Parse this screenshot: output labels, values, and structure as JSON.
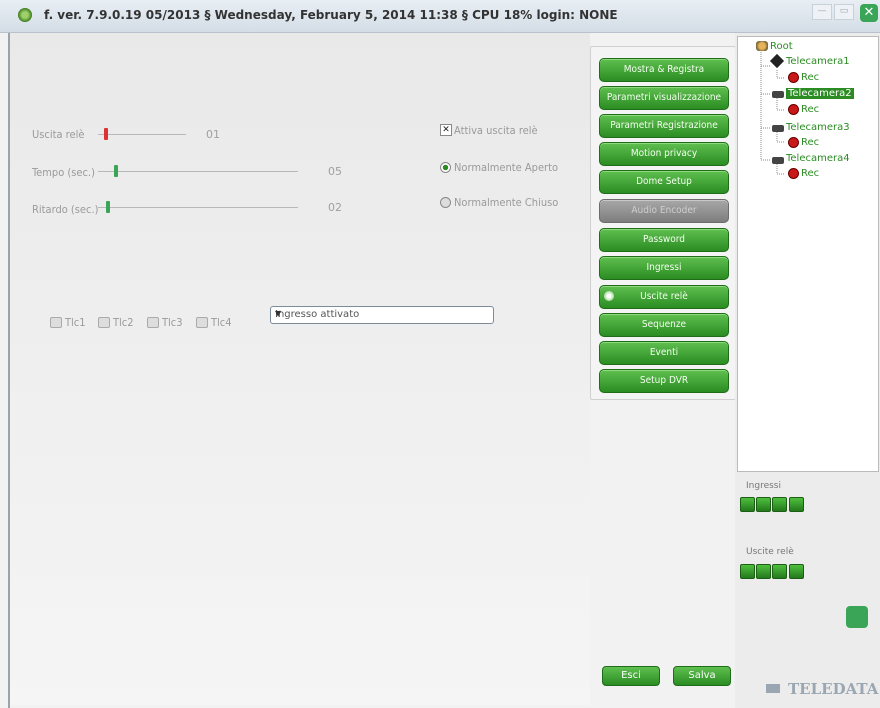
{
  "titlebar": {
    "title": "f. ver. 7.9.0.19  05/2013   § Wednesday, February 5, 2014 11:38   § CPU 18%   login: NONE",
    "min_label": "—",
    "max_label": "▭",
    "close_label": "✕"
  },
  "relay": {
    "uscita_label": "Uscita relè",
    "uscita_value": "01",
    "tempo_label": "Tempo (sec.)",
    "tempo_value": "05",
    "ritardo_label": "Ritardo (sec.)",
    "ritardo_value": "02",
    "attiva_label": "Attiva uscita relè",
    "aperto_label": "Normalmente Aperto",
    "chiuso_label": "Normalmente Chiuso"
  },
  "tlc": [
    "Tlc1",
    "Tlc2",
    "Tlc3",
    "Tlc4"
  ],
  "select": {
    "value": "Ingresso attivato"
  },
  "buttons": [
    {
      "label": "Mostra & Registra",
      "enabled": true
    },
    {
      "label": "Parametri visualizzazione",
      "enabled": true
    },
    {
      "label": "Parametri Registrazione",
      "enabled": true
    },
    {
      "label": "Motion privacy",
      "enabled": true
    },
    {
      "label": "Dome Setup",
      "enabled": true
    },
    {
      "label": "Audio Encoder",
      "enabled": false
    },
    {
      "label": "Password",
      "enabled": true
    },
    {
      "label": "Ingressi",
      "enabled": true
    },
    {
      "label": "Uscite relè",
      "enabled": true
    },
    {
      "label": "Sequenze",
      "enabled": true
    },
    {
      "label": "Eventi",
      "enabled": true
    },
    {
      "label": "Setup DVR",
      "enabled": true
    }
  ],
  "tree": {
    "root": "Root",
    "cameras": [
      "Telecamera1",
      "Telecamera2",
      "Telecamera3",
      "Telecamera4"
    ],
    "rec_label": "Rec",
    "selected": "Telecamera2"
  },
  "ingressi": {
    "label": "Ingressi"
  },
  "uscite": {
    "label": "Uscite relè"
  },
  "footer": {
    "esci_label": "Esci",
    "salva_label": "Salva"
  },
  "logo": "TELEDATA",
  "colors": {
    "accent": "#2a8c22",
    "rec": "#c81818"
  }
}
